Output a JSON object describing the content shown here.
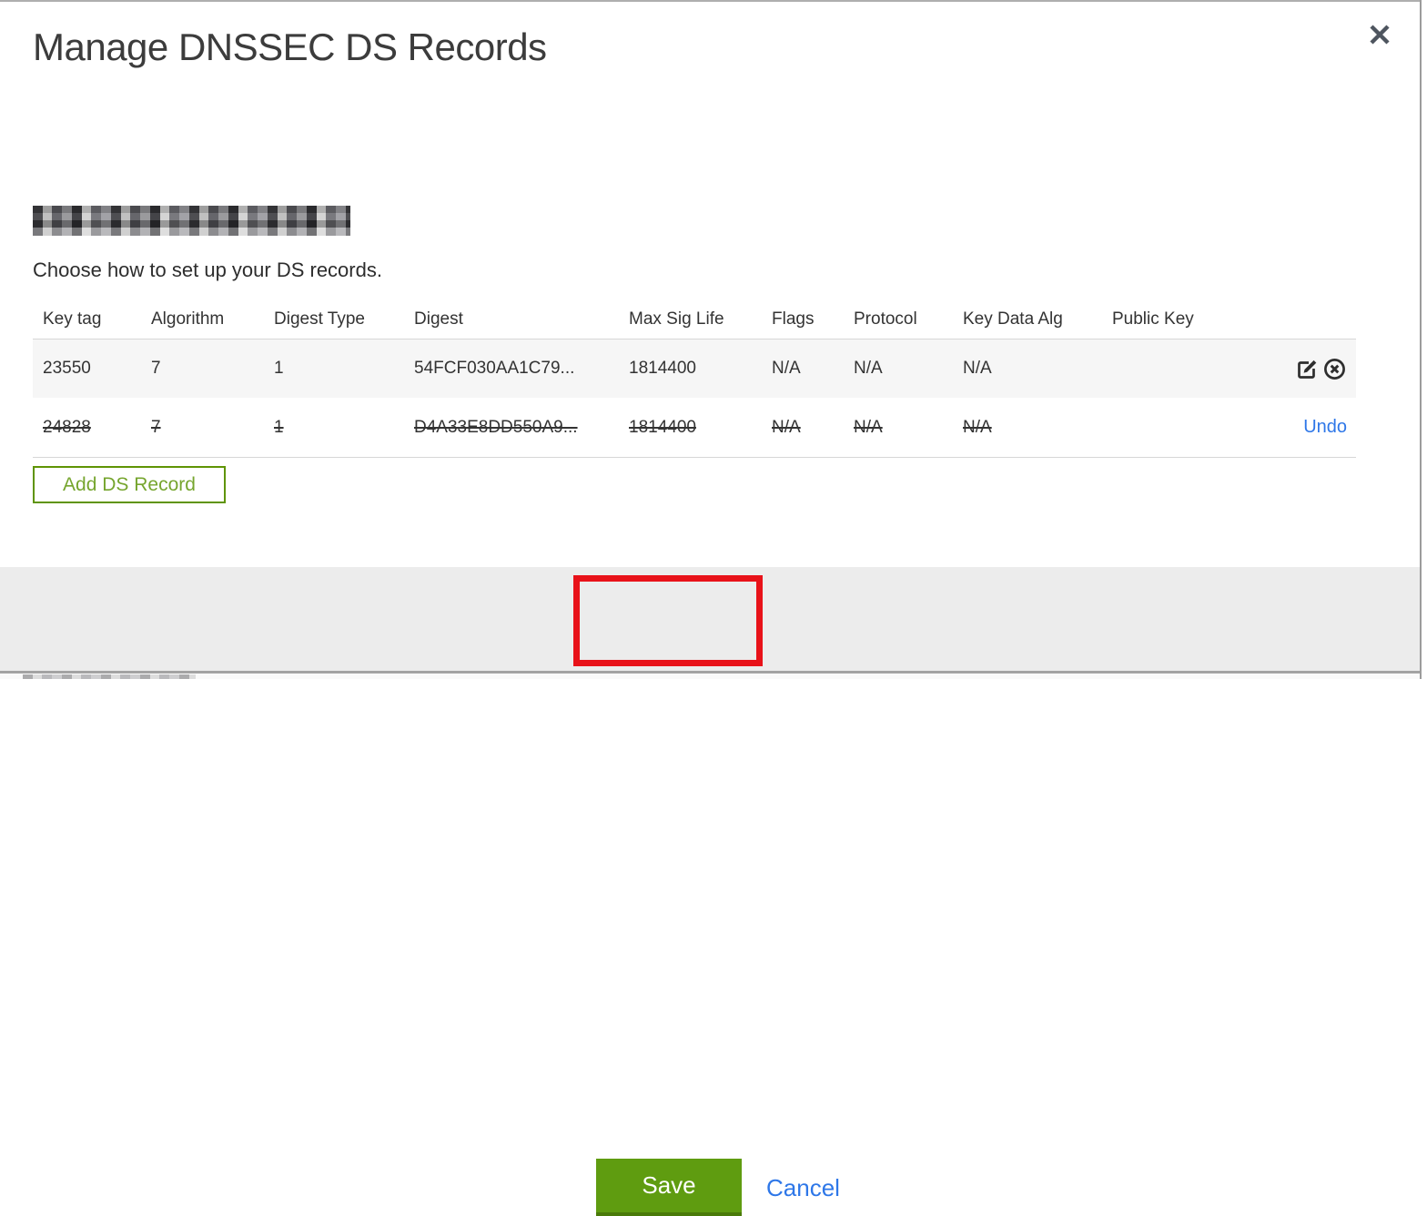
{
  "dialog": {
    "title": "Manage DNSSEC DS Records",
    "subtitle": "Choose how to set up your DS records.",
    "domain_redacted": true,
    "add_record_button": "Add DS Record",
    "save_button": "Save",
    "cancel_link": "Cancel",
    "undo_link": "Undo"
  },
  "table": {
    "headers": [
      "Key tag",
      "Algorithm",
      "Digest Type",
      "Digest",
      "Max Sig Life",
      "Flags",
      "Protocol",
      "Key Data Alg",
      "Public Key"
    ],
    "rows": [
      {
        "state": "normal",
        "cells": [
          "23550",
          "7",
          "1",
          "54FCF030AA1C79...",
          "1814400",
          "N/A",
          "N/A",
          "N/A",
          ""
        ],
        "actions": [
          "edit",
          "delete"
        ]
      },
      {
        "state": "deleted",
        "cells": [
          "24828",
          "7",
          "1",
          "D4A33E8DD550A9...",
          "1814400",
          "N/A",
          "N/A",
          "N/A",
          ""
        ],
        "actions": [
          "undo"
        ]
      }
    ]
  },
  "icons": {
    "close": "x-mark",
    "edit": "pencil-on-square",
    "delete": "x-in-circle"
  },
  "colors": {
    "save_green": "#5f9c10",
    "outline_green": "#5f9404",
    "link_blue": "#2e77e8",
    "annotation_red": "#e81219"
  }
}
